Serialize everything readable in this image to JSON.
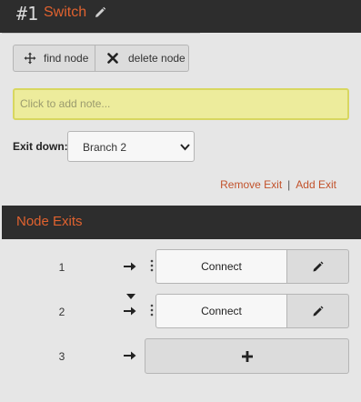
{
  "header": {
    "number": "#1",
    "title": "Switch"
  },
  "toolbar": {
    "find_label": "find node",
    "delete_label": "delete node"
  },
  "note": {
    "placeholder": "Click to add note..."
  },
  "exit_down": {
    "label": "Exit down:",
    "selected": "Branch 2"
  },
  "exit_links": {
    "remove": "Remove Exit",
    "separator": "|",
    "add": "Add Exit"
  },
  "node_exits": {
    "title": "Node Exits",
    "rows": [
      {
        "number": "1",
        "connect_label": "Connect"
      },
      {
        "number": "2",
        "connect_label": "Connect"
      },
      {
        "number": "3"
      }
    ]
  },
  "colors": {
    "accent": "#e0622f",
    "header_bg": "#2d2d2d",
    "note_bg": "#edec9c",
    "link": "#c2522b"
  }
}
